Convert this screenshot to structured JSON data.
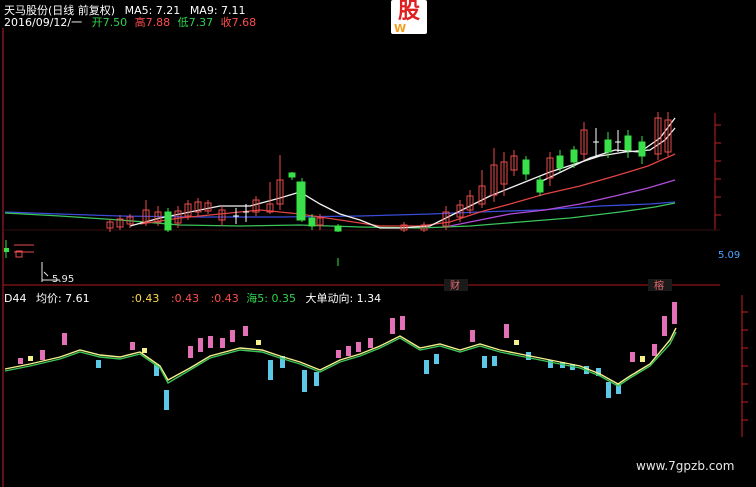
{
  "header": {
    "stock_line": "天马股份(日线 前复权)",
    "ma5": "MA5: 7.21",
    "ma9": "MA9: 7.11",
    "date": "2016/09/12/一",
    "open": "开7.50",
    "high": "高7.88",
    "low": "低7.37",
    "close": "收7.68"
  },
  "logo": {
    "text": "股",
    "sub": "W"
  },
  "main_chart": {
    "low_marker": "5.95",
    "cai_label": "财",
    "rong_label": "榕",
    "right_value": "5.09"
  },
  "indicator": {
    "name": "D44",
    "avg_label": "均价: 7.61",
    "v1": ":0.43",
    "v2": ":0.43",
    "v3": ":0.43",
    "hai5": "海5: 0.35",
    "dadan": "大单动向: 1.34"
  },
  "watermark": "www.7gpzb.com",
  "colors": {
    "up": "#e84c4c",
    "down": "#39e049",
    "accent_red": "#d9202a",
    "pink_bar": "#e36fb6",
    "cyan_bar": "#5ac8e6",
    "yellow_bar": "#f4f08a",
    "ma_white": "#f2f2f2",
    "ma_red": "#e04343",
    "ma_purple": "#b04ddb",
    "ma_green": "#3cc45a",
    "ma_blue": "#3a4bd8"
  }
}
